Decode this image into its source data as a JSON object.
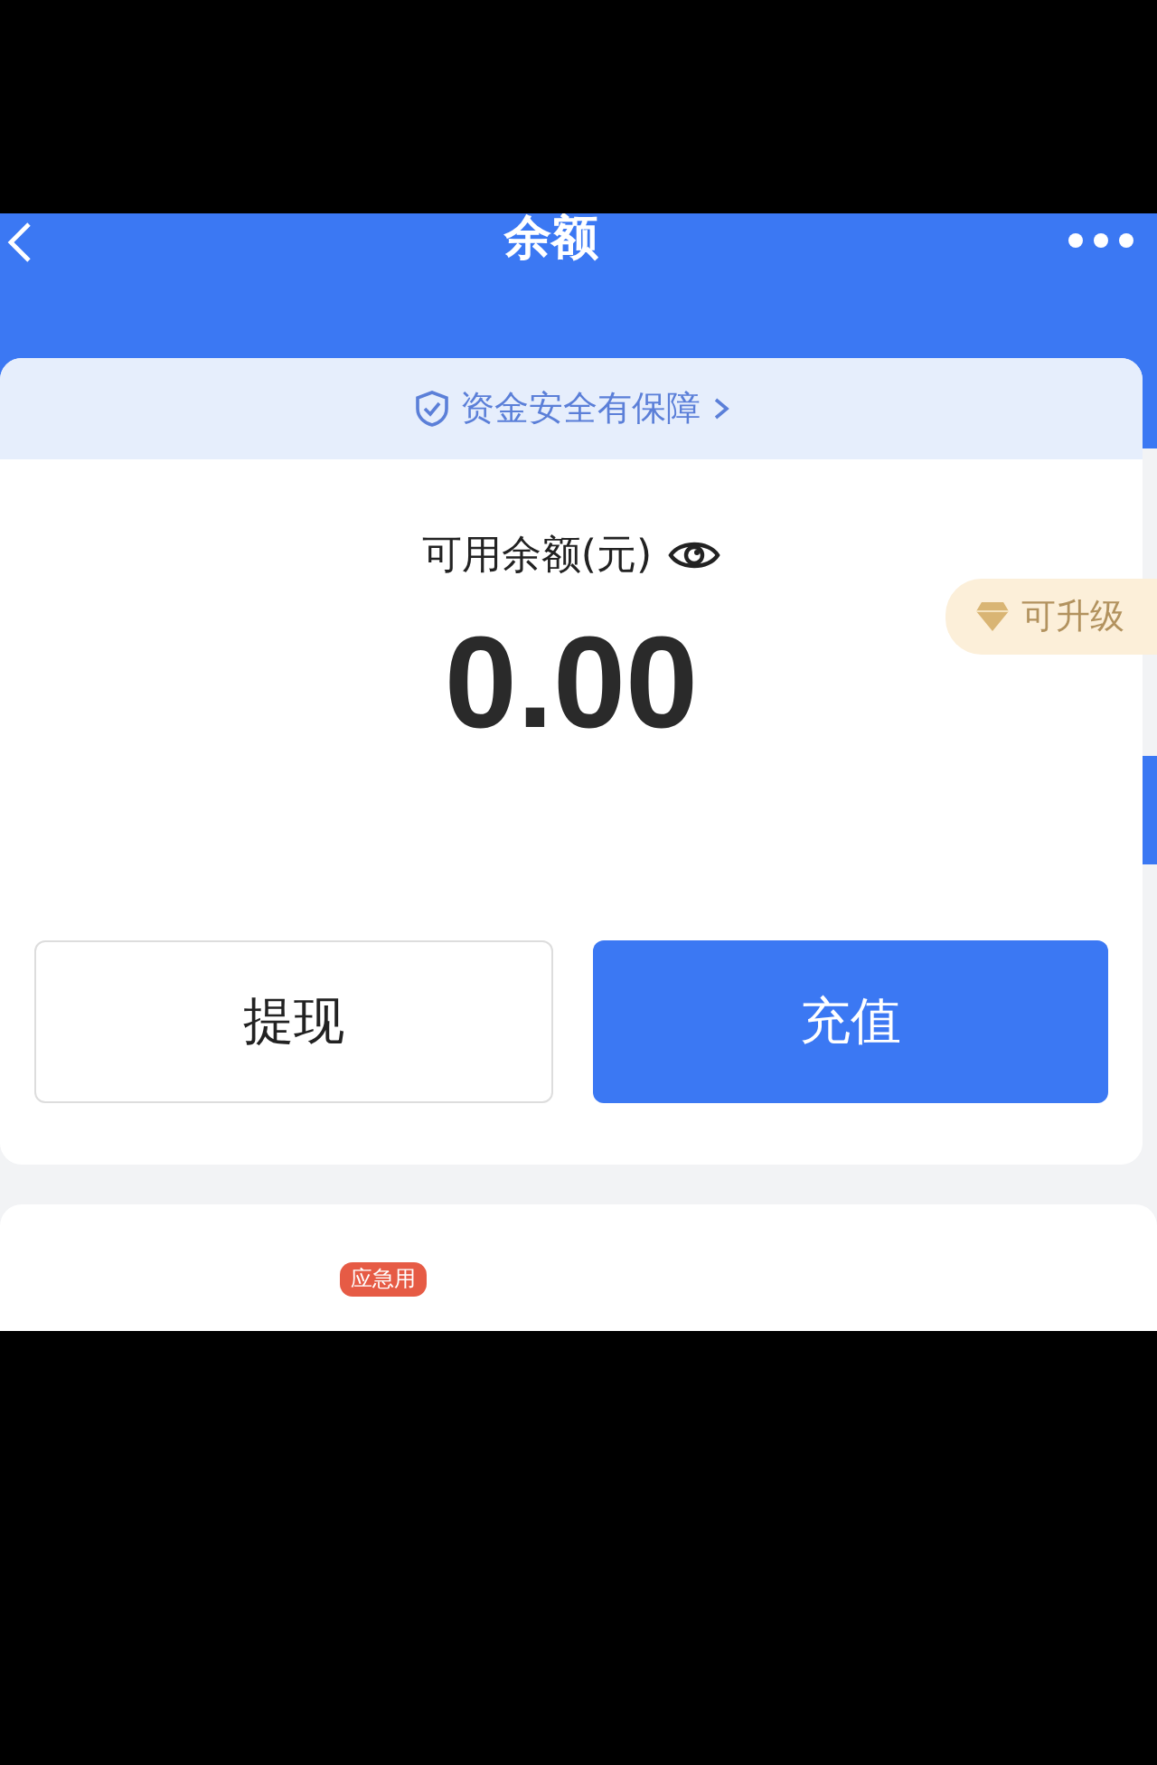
{
  "header": {
    "title": "余额"
  },
  "security_banner": {
    "text": "资金安全有保障"
  },
  "balance": {
    "label": "可用余额(元)",
    "amount": "0.00",
    "upgrade_badge": "可升级"
  },
  "buttons": [
    {
      "label": "提现",
      "kind": "secondary"
    },
    {
      "label": "充值",
      "kind": "primary"
    }
  ],
  "next_card": {
    "badge": "应急用"
  }
}
